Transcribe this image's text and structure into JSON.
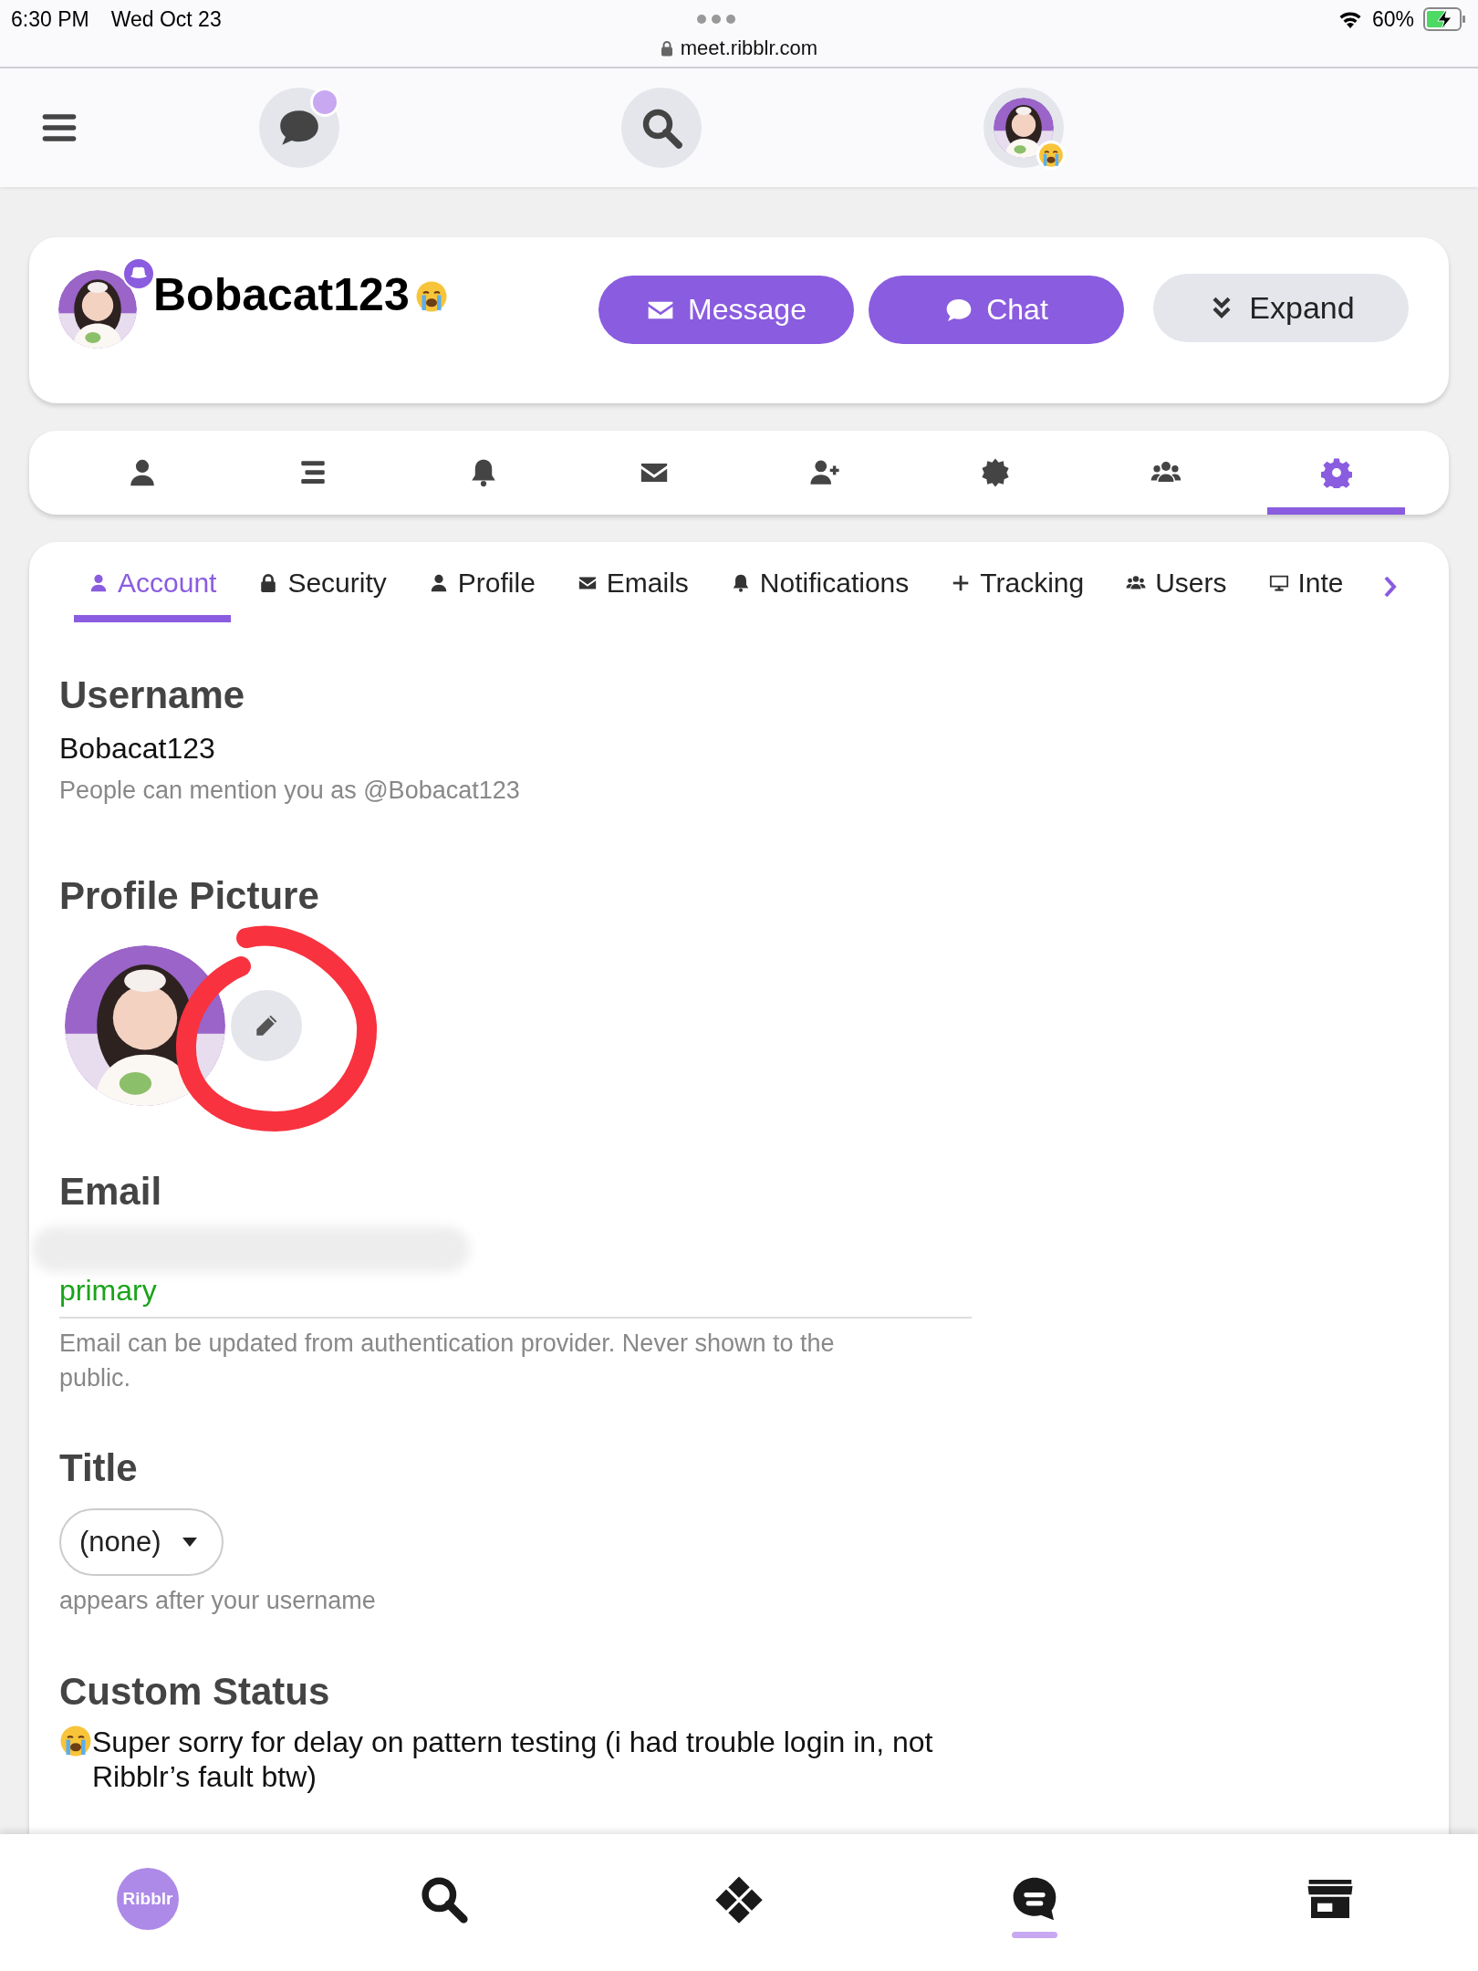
{
  "status_bar": {
    "time": "6:30 PM",
    "date": "Wed Oct 23",
    "url": "meet.ribblr.com",
    "battery": "60%",
    "charging": true
  },
  "top_nav": {
    "items": [
      {
        "kind": "menu"
      },
      {
        "kind": "chat",
        "unread": true
      },
      {
        "kind": "search"
      },
      {
        "kind": "avatar"
      }
    ]
  },
  "profile": {
    "username": "Bobacat123",
    "buttons": [
      {
        "label": "Message",
        "kind": "message"
      },
      {
        "label": "Chat",
        "kind": "chat"
      },
      {
        "label": "Expand",
        "kind": "expand"
      }
    ]
  },
  "section_tabs": [
    {
      "kind": "person",
      "selected": false
    },
    {
      "kind": "list",
      "selected": false
    },
    {
      "kind": "bell",
      "selected": false
    },
    {
      "kind": "envelope",
      "selected": false
    },
    {
      "kind": "user-plus",
      "selected": false
    },
    {
      "kind": "badge",
      "selected": false
    },
    {
      "kind": "users",
      "selected": false
    },
    {
      "kind": "gear",
      "selected": true
    }
  ],
  "settings_tabs": [
    {
      "label": "Account",
      "kind": "person",
      "selected": true
    },
    {
      "label": "Security",
      "kind": "lock",
      "selected": false
    },
    {
      "label": "Profile",
      "kind": "person",
      "selected": false
    },
    {
      "label": "Emails",
      "kind": "envelope",
      "selected": false
    },
    {
      "label": "Notifications",
      "kind": "bell",
      "selected": false
    },
    {
      "label": "Tracking",
      "kind": "plus",
      "selected": false
    },
    {
      "label": "Users",
      "kind": "users",
      "selected": false
    },
    {
      "label": "Inte",
      "kind": "monitor",
      "selected": false
    }
  ],
  "username": {
    "heading": "Username",
    "value": "Bobacat123",
    "hint": "People can mention you as @Bobacat123"
  },
  "profile_picture": {
    "heading": "Profile Picture"
  },
  "email": {
    "heading": "Email",
    "badge": "primary",
    "hint": "Email can be updated from authentication provider. Never shown to the public."
  },
  "title": {
    "heading": "Title",
    "value": "(none)",
    "hint": "appears after your username"
  },
  "custom_status": {
    "heading": "Custom Status",
    "text": "Super sorry for delay on pattern testing (i had trouble login in, not Ribblr’s fault btw)"
  },
  "bottom_nav": [
    {
      "kind": "logo",
      "label": "Ribblr",
      "selected": false
    },
    {
      "kind": "search",
      "selected": false
    },
    {
      "kind": "patterns",
      "selected": false
    },
    {
      "kind": "chat",
      "selected": true
    },
    {
      "kind": "shop",
      "selected": false
    }
  ]
}
